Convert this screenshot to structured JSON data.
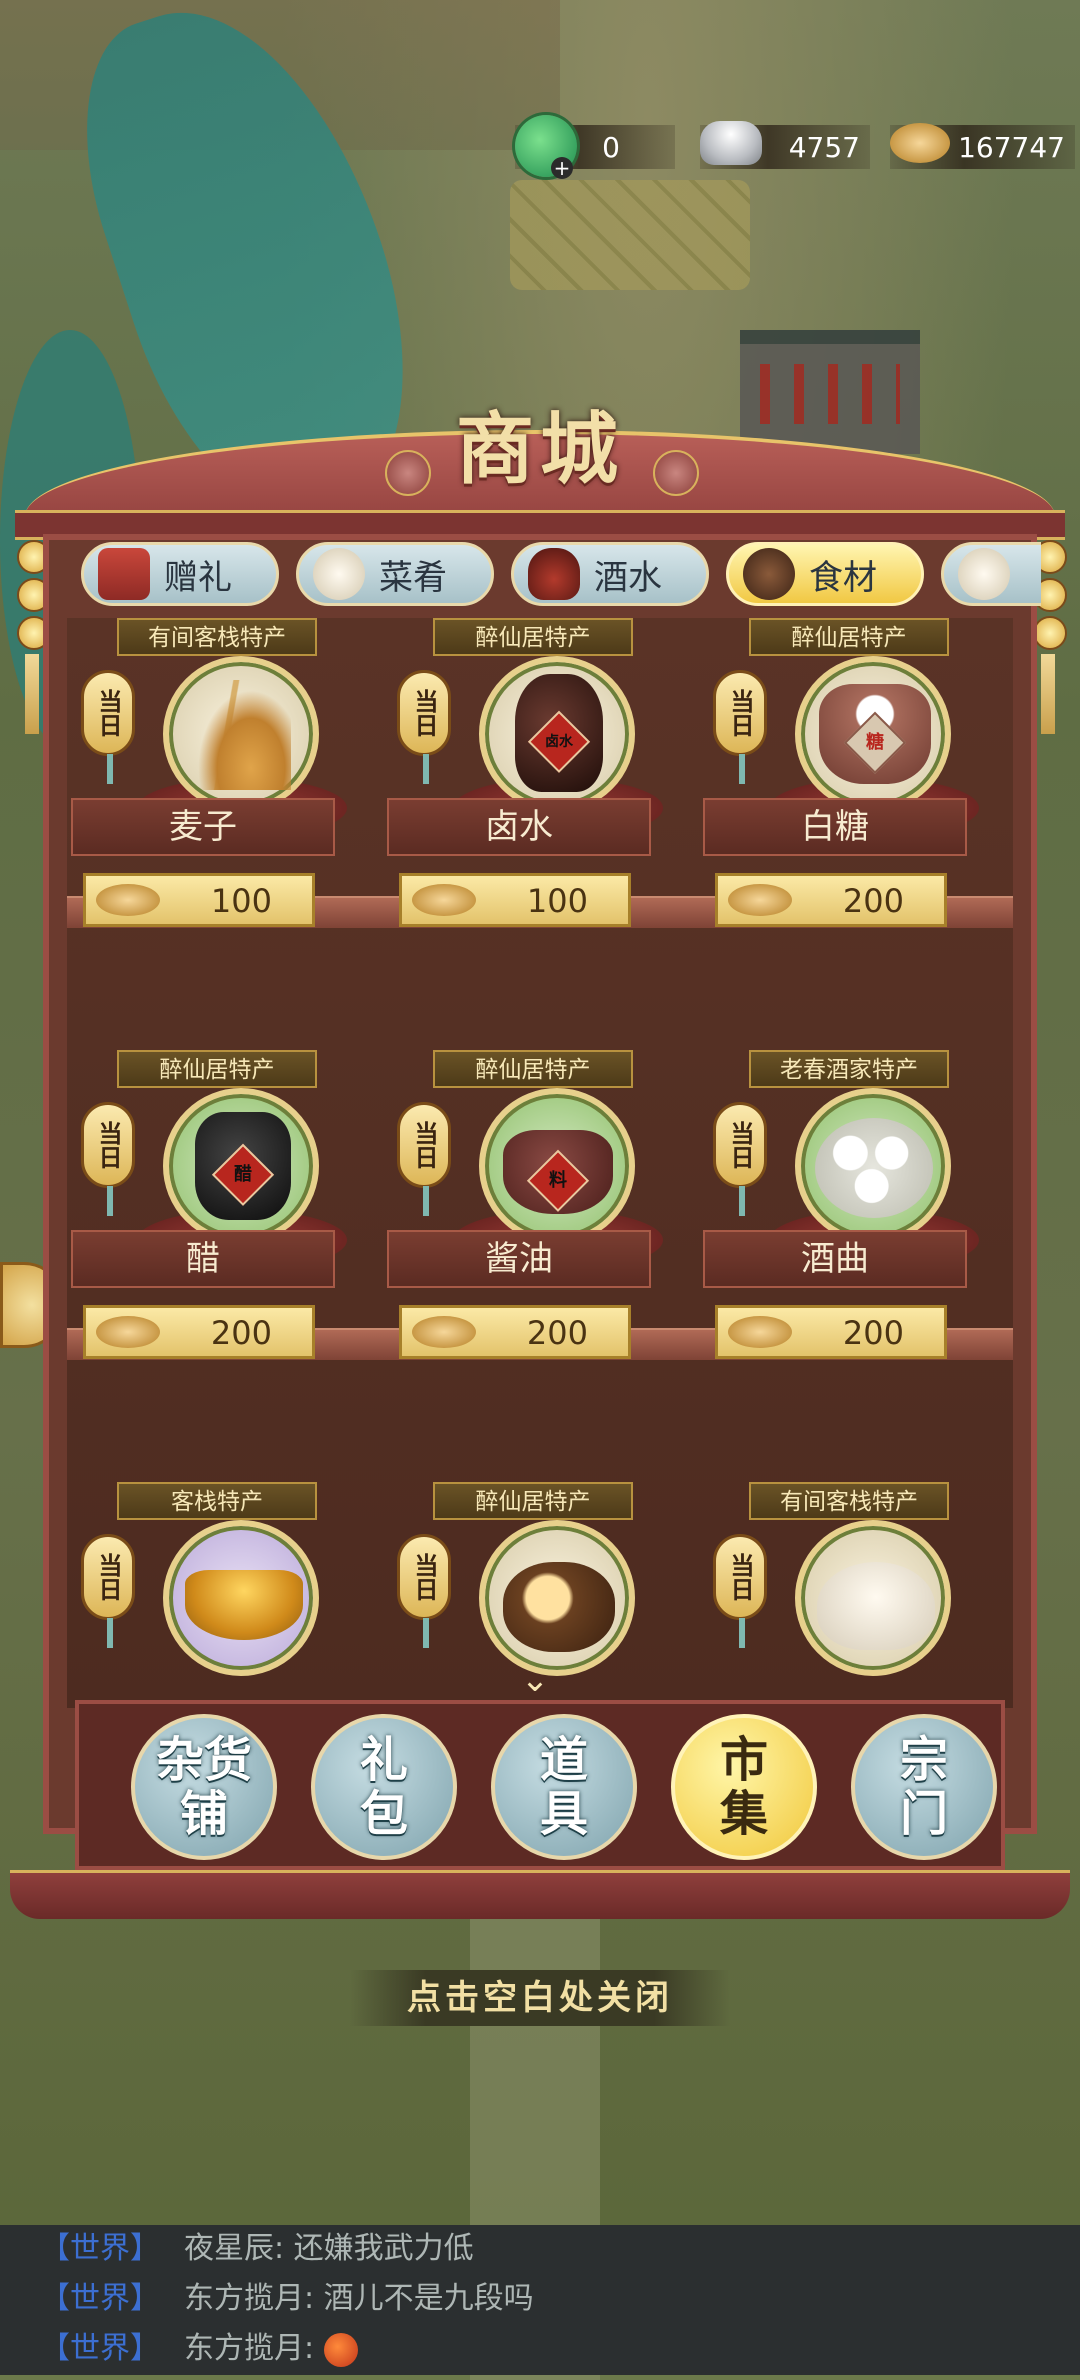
{
  "currency": {
    "jade": "0",
    "silver": "4757",
    "coins": "167747"
  },
  "shop": {
    "title": "商城",
    "tabs": [
      {
        "label": "赠礼",
        "icon": "gift-icon"
      },
      {
        "label": "菜肴",
        "icon": "dish-icon"
      },
      {
        "label": "酒水",
        "icon": "wine-jar-icon"
      },
      {
        "label": "食材",
        "icon": "ingredient-icon",
        "active": true
      }
    ],
    "daily_tag": "当日",
    "items": [
      {
        "origin": "有间客栈特产",
        "name": "麦子",
        "price": "100",
        "icon": "wheat-icon"
      },
      {
        "origin": "醉仙居特产",
        "name": "卤水",
        "price": "100",
        "icon": "brine-jar-icon",
        "label": "卤水"
      },
      {
        "origin": "醉仙居特产",
        "name": "白糖",
        "price": "200",
        "icon": "sugar-sack-icon",
        "label": "糖"
      },
      {
        "origin": "醉仙居特产",
        "name": "醋",
        "price": "200",
        "icon": "vinegar-jar-icon",
        "label": "醋"
      },
      {
        "origin": "醉仙居特产",
        "name": "酱油",
        "price": "200",
        "icon": "soy-sauce-pot-icon",
        "label": "料"
      },
      {
        "origin": "老春酒家特产",
        "name": "酒曲",
        "price": "200",
        "icon": "yeast-balls-icon"
      },
      {
        "origin": "客栈特产",
        "name": "",
        "price": "",
        "icon": "honey-bowl-icon"
      },
      {
        "origin": "醉仙居特产",
        "name": "",
        "price": "",
        "icon": "tuber-icon"
      },
      {
        "origin": "有间客栈特产",
        "name": "",
        "price": "",
        "icon": "dumpling-icon"
      }
    ],
    "categories": [
      "杂货铺",
      "礼包",
      "道具",
      "市集",
      "宗门"
    ],
    "active_category": "市集",
    "close_hint": "点击空白处关闭"
  },
  "chat": [
    {
      "channel": "【世界】",
      "text": "夜星辰: 还嫌我武力低"
    },
    {
      "channel": "【世界】",
      "text": "东方揽月: 酒儿不是九段吗"
    },
    {
      "channel": "【世界】",
      "text": "东方揽月:"
    }
  ],
  "colors": {
    "frame": "#8f3f3c",
    "gold": "#e3c36b",
    "active_tab": "#f1c843",
    "chat_channel": "#3c6fd2"
  }
}
